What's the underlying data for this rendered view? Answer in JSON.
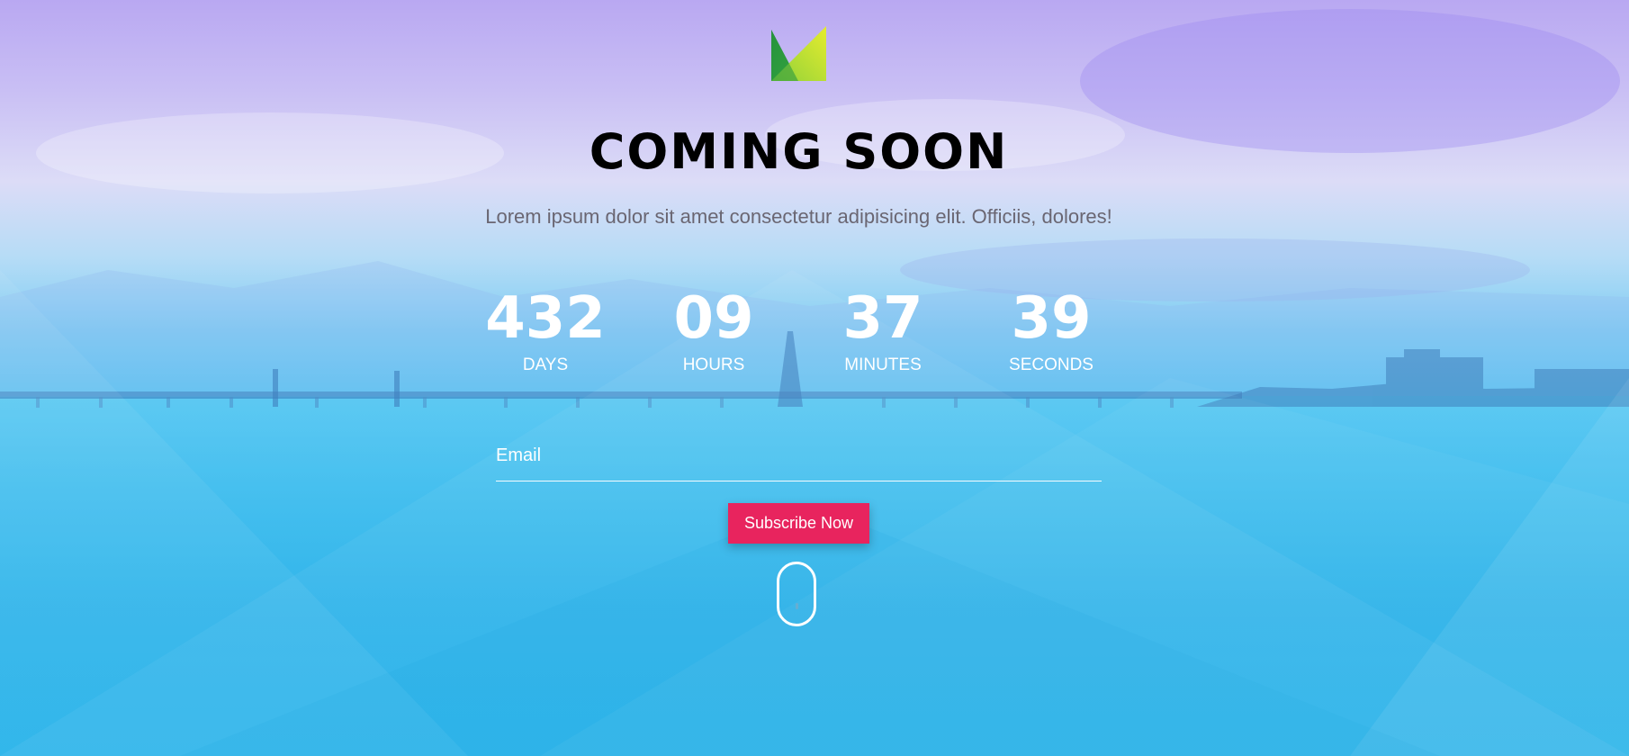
{
  "logo": {
    "icon": "m-logo-icon",
    "colors": [
      "#1f8a3a",
      "#8fd13a",
      "#d8e830"
    ]
  },
  "hero": {
    "title": "COMING SOON",
    "subtitle": "Lorem ipsum dolor sit amet consectetur adipisicing elit. Officiis, dolores!"
  },
  "countdown": [
    {
      "value": "432",
      "label": "DAYS"
    },
    {
      "value": "09",
      "label": "HOURS"
    },
    {
      "value": "37",
      "label": "MINUTES"
    },
    {
      "value": "39",
      "label": "SECONDS"
    }
  ],
  "subscribe": {
    "email_placeholder": "Email",
    "email_value": "",
    "button_label": "Subscribe Now",
    "button_color": "#e8245e"
  },
  "scroll_indicator": {
    "icon": "mouse-scroll-icon"
  }
}
